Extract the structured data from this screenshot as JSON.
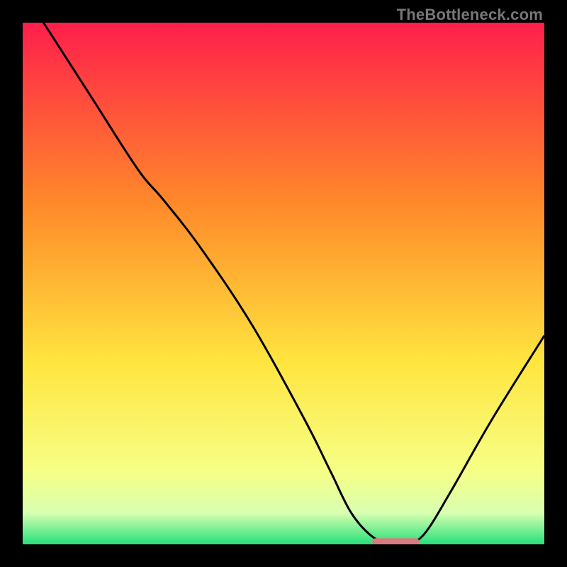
{
  "watermark": "TheBottleneck.com",
  "colors": {
    "gradient_top": "#ff1f4b",
    "gradient_upper_mid": "#ff8a2a",
    "gradient_mid": "#ffe53f",
    "gradient_lower_mid": "#f6ff86",
    "gradient_band": "#d8ffb0",
    "gradient_bottom": "#26e07a",
    "curve_stroke": "#000000",
    "marker_fill": "#d97a7f",
    "frame": "#000000"
  },
  "chart_data": {
    "type": "line",
    "title": "",
    "xlabel": "",
    "ylabel": "",
    "xlim": [
      0,
      100
    ],
    "ylim": [
      0,
      100
    ],
    "curve": [
      {
        "x": 4,
        "y": 100
      },
      {
        "x": 13,
        "y": 86
      },
      {
        "x": 22,
        "y": 72
      },
      {
        "x": 27,
        "y": 66
      },
      {
        "x": 34,
        "y": 57
      },
      {
        "x": 44,
        "y": 42
      },
      {
        "x": 54,
        "y": 24
      },
      {
        "x": 59,
        "y": 14
      },
      {
        "x": 63,
        "y": 6
      },
      {
        "x": 67,
        "y": 1.5
      },
      {
        "x": 70,
        "y": 0.5
      },
      {
        "x": 74,
        "y": 0.5
      },
      {
        "x": 77,
        "y": 2
      },
      {
        "x": 82,
        "y": 10
      },
      {
        "x": 90,
        "y": 24
      },
      {
        "x": 100,
        "y": 40
      }
    ],
    "optimum_marker": {
      "x_start": 67,
      "x_end": 76,
      "y": 0.5
    }
  }
}
